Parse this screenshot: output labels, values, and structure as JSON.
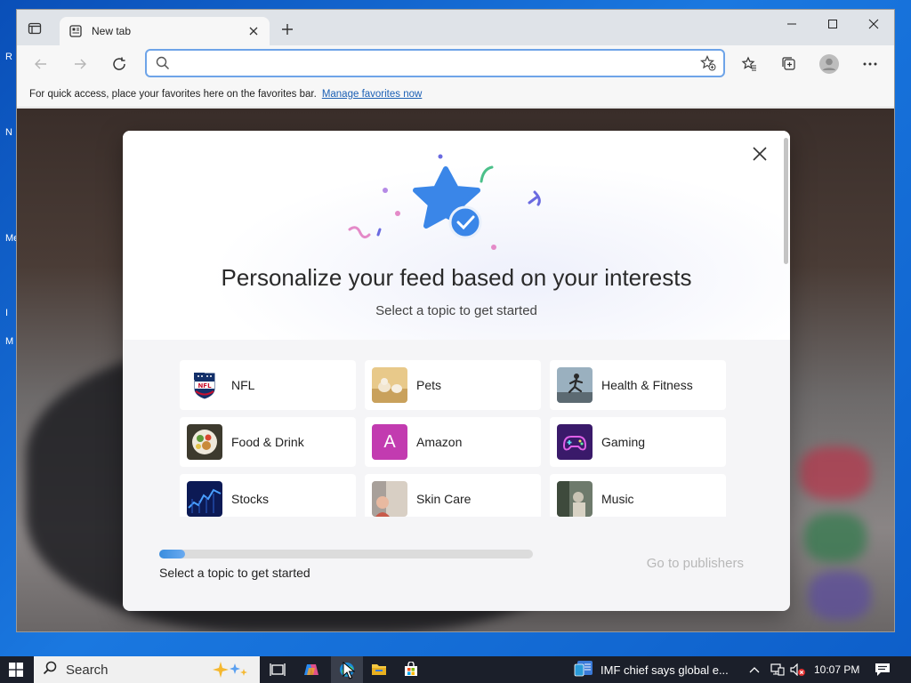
{
  "desktop": {
    "fragments": [
      "R",
      "N",
      "Me",
      "I",
      "M"
    ]
  },
  "browser": {
    "tab": {
      "title": "New tab"
    },
    "address_bar": {
      "placeholder": "",
      "value": ""
    },
    "favorites_bar": {
      "message": "For quick access, place your favorites here on the favorites bar.",
      "link": "Manage favorites now"
    }
  },
  "modal": {
    "title": "Personalize your feed based on your interests",
    "subtitle": "Select a topic to get started",
    "topics": [
      {
        "label": "NFL",
        "icon": "nfl-logo"
      },
      {
        "label": "Pets",
        "icon": "pets-photo"
      },
      {
        "label": "Health & Fitness",
        "icon": "health-photo"
      },
      {
        "label": "Food & Drink",
        "icon": "food-photo"
      },
      {
        "label": "Amazon",
        "icon": "amazon-letter",
        "letter": "A"
      },
      {
        "label": "Gaming",
        "icon": "gaming-photo"
      },
      {
        "label": "Stocks",
        "icon": "stocks-photo"
      },
      {
        "label": "Skin Care",
        "icon": "skincare-photo"
      },
      {
        "label": "Music",
        "icon": "music-photo"
      }
    ],
    "progress": {
      "fraction": 0.07,
      "label": "Select a topic to get started"
    },
    "go_button": "Go to publishers"
  },
  "taskbar": {
    "search_label": "Search",
    "news_text": "IMF chief says global e...",
    "time": "10:07 PM"
  },
  "colors": {
    "accent": "#1a5fb4",
    "star": "#3a86e8",
    "amazon_tile": "#c23bb0",
    "taskbar": "#1b1f2a"
  }
}
